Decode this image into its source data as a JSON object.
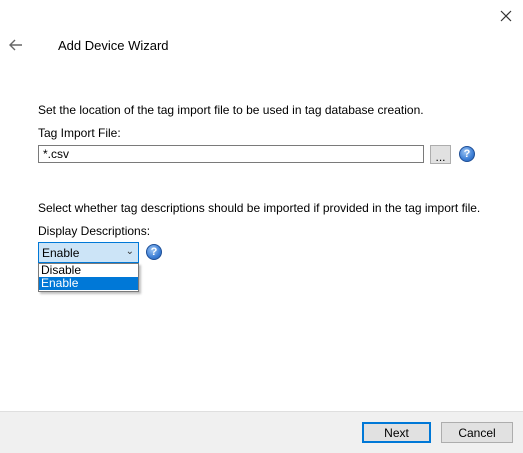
{
  "window": {
    "title": "Add Device Wizard",
    "close_icon": "close-icon",
    "back_icon": "back-arrow-icon"
  },
  "import_file": {
    "prompt": "Set the location of the tag import file to be used in tag database creation.",
    "label": "Tag Import File:",
    "value": "*.csv",
    "browse_label": "...",
    "help_icon": "help-icon"
  },
  "descriptions": {
    "prompt": "Select whether tag descriptions should be imported if provided in the tag import file.",
    "label": "Display Descriptions:",
    "selected": "Enable",
    "options": [
      "Disable",
      "Enable"
    ],
    "help_icon": "help-icon"
  },
  "footer": {
    "next_label": "Next",
    "cancel_label": "Cancel"
  },
  "colors": {
    "accent": "#0078d7",
    "footer_bg": "#f0f0f0"
  }
}
